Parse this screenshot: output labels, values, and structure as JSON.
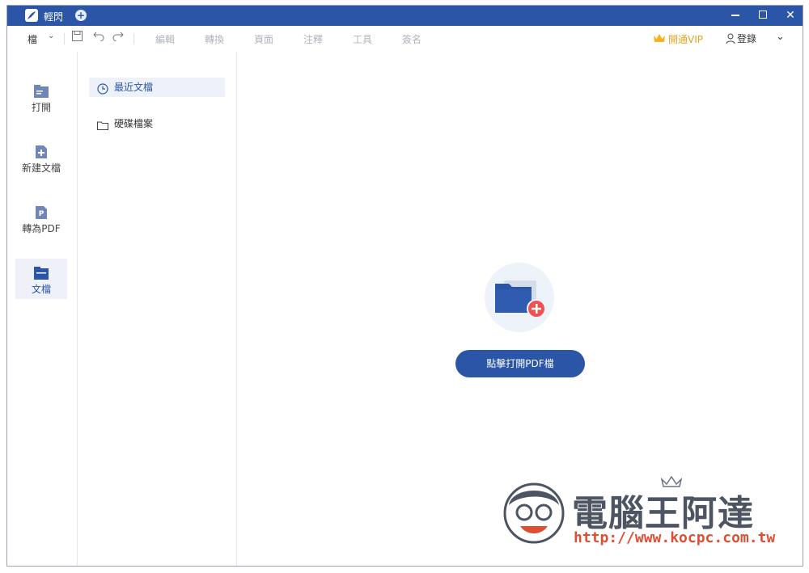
{
  "titlebar": {
    "title": "輕閃",
    "add_tab": "+",
    "minimize": "–",
    "close": "✕"
  },
  "toolbar": {
    "file": "檔",
    "menu": [
      "編輯",
      "轉換",
      "頁面",
      "注釋",
      "工具",
      "簽名"
    ],
    "vip": "開通VIP",
    "login": "登錄"
  },
  "rail": {
    "items": [
      {
        "label": "打開"
      },
      {
        "label": "新建文檔"
      },
      {
        "label": "轉為PDF"
      },
      {
        "label": "文檔"
      }
    ]
  },
  "panel2": {
    "items": [
      {
        "label": "最近文檔"
      },
      {
        "label": "硬碟檔案"
      }
    ]
  },
  "main": {
    "open_button": "點擊打開PDF檔"
  },
  "watermark": {
    "title": "電腦王阿達",
    "url": "http://www.kocpc.com.tw"
  },
  "colors": {
    "brand": "#2b56a8",
    "vip": "#e8a320",
    "accent_red": "#ef5350"
  }
}
